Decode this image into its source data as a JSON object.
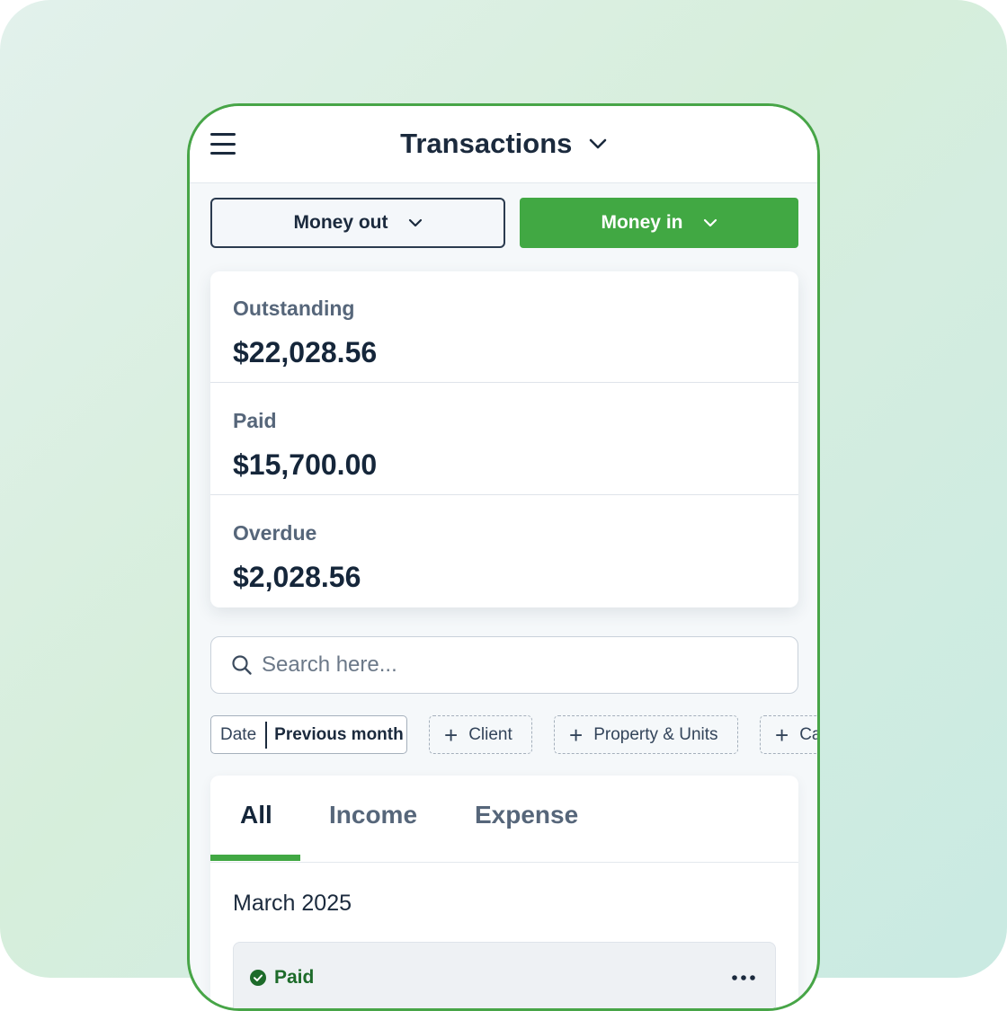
{
  "header": {
    "title": "Transactions"
  },
  "toggle": {
    "money_out": "Money out",
    "money_in": "Money in"
  },
  "summary": {
    "items": [
      {
        "label": "Outstanding",
        "value": "$22,028.56"
      },
      {
        "label": "Paid",
        "value": "$15,700.00"
      },
      {
        "label": "Overdue",
        "value": "$2,028.56"
      }
    ]
  },
  "search": {
    "placeholder": "Search here..."
  },
  "filters": {
    "date_label": "Date",
    "date_value": "Previous month",
    "chips": [
      "Client",
      "Property & Units",
      "Ca"
    ]
  },
  "tabs": [
    "All",
    "Income",
    "Expense"
  ],
  "active_tab": "All",
  "list": {
    "month": "March 2025",
    "rows": [
      {
        "status": "Paid"
      }
    ]
  },
  "colors": {
    "accent": "#41a843",
    "frame": "#47a547",
    "text_dark": "#1b2a3d",
    "text_muted": "#56667a",
    "paid_status": "#1d6b2a"
  },
  "icons": {
    "menu": "hamburger-menu-icon",
    "title_dropdown": "chevron-down-icon",
    "search": "search-icon",
    "add": "plus-icon",
    "status": "check-circle-icon",
    "more": "more-horizontal-icon"
  }
}
